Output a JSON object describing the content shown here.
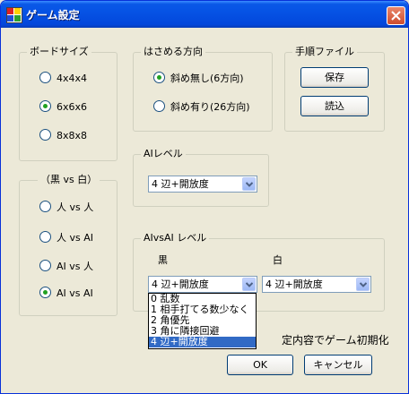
{
  "window": {
    "title": "ゲーム設定"
  },
  "board": {
    "title": "ボードサイズ",
    "options": [
      {
        "label": "4x4x4",
        "selected": false
      },
      {
        "label": "6x6x6",
        "selected": true
      },
      {
        "label": "8x8x8",
        "selected": false
      }
    ]
  },
  "capture": {
    "title": "はさめる方向",
    "options": [
      {
        "label": "斜め無し(6方向)",
        "selected": true
      },
      {
        "label": "斜め有り(26方向)",
        "selected": false
      }
    ]
  },
  "record": {
    "title": "手順ファイル",
    "save_label": "保存",
    "load_label": "読込"
  },
  "ai_level": {
    "title": "AIレベル",
    "value": "4 辺+開放度"
  },
  "players": {
    "title": "（黒 vs 白）",
    "options": [
      {
        "label": "人 vs 人",
        "selected": false
      },
      {
        "label": "人 vs AI",
        "selected": false
      },
      {
        "label": "AI vs 人",
        "selected": false
      },
      {
        "label": "AI vs AI",
        "selected": true
      }
    ]
  },
  "ai_vs_ai": {
    "title": "AIvsAI レベル",
    "black_label": "黒",
    "white_label": "白",
    "black_value": "4 辺+開放度",
    "white_value": "4 辺+開放度",
    "dropdown_options": [
      {
        "label": "0 乱数",
        "selected": false
      },
      {
        "label": "1 相手打てる数少なく",
        "selected": false
      },
      {
        "label": "2 角優先",
        "selected": false
      },
      {
        "label": "3 角に隣接回避",
        "selected": false
      },
      {
        "label": "4 辺+開放度",
        "selected": true
      }
    ]
  },
  "footer": {
    "note": "定内容でゲーム初期化",
    "ok_label": "OK",
    "cancel_label": "キャンセル"
  },
  "colors": {
    "title_bar": "#0A58E6",
    "selection": "#316AC5",
    "face": "#ECE9D8"
  }
}
